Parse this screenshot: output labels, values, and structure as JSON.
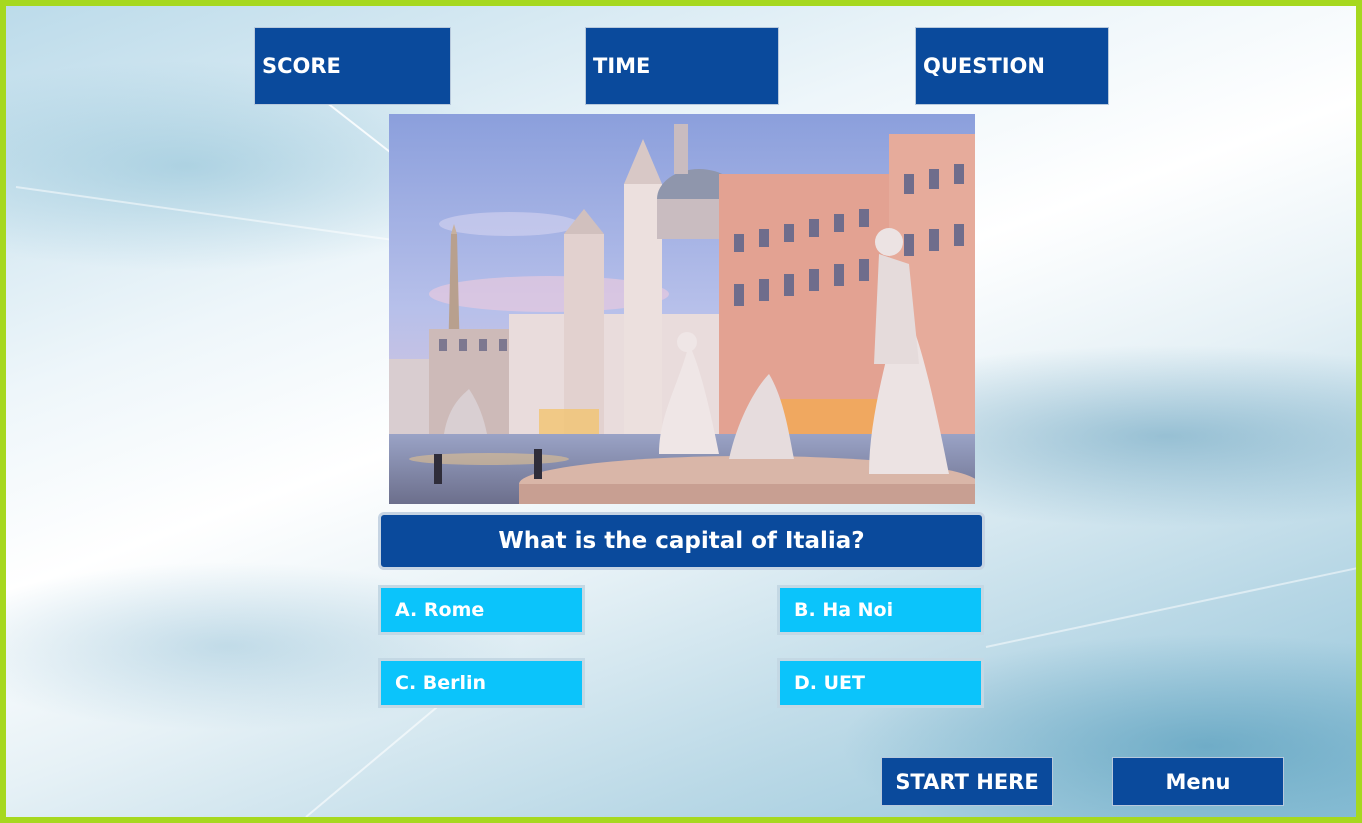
{
  "header": {
    "score_label": "SCORE",
    "time_label": "TIME",
    "question_label": "QUESTION"
  },
  "quiz": {
    "question": "What is the capital of Italia?",
    "answers": [
      "A. Rome",
      "B. Ha Noi",
      "C. Berlin",
      "D. UET"
    ]
  },
  "controls": {
    "start_label": "START HERE",
    "menu_label": "Menu"
  },
  "colors": {
    "frame_border": "#a6d81f",
    "panel_blue": "#0a4a9c",
    "answer_cyan": "#0bc4fb"
  }
}
